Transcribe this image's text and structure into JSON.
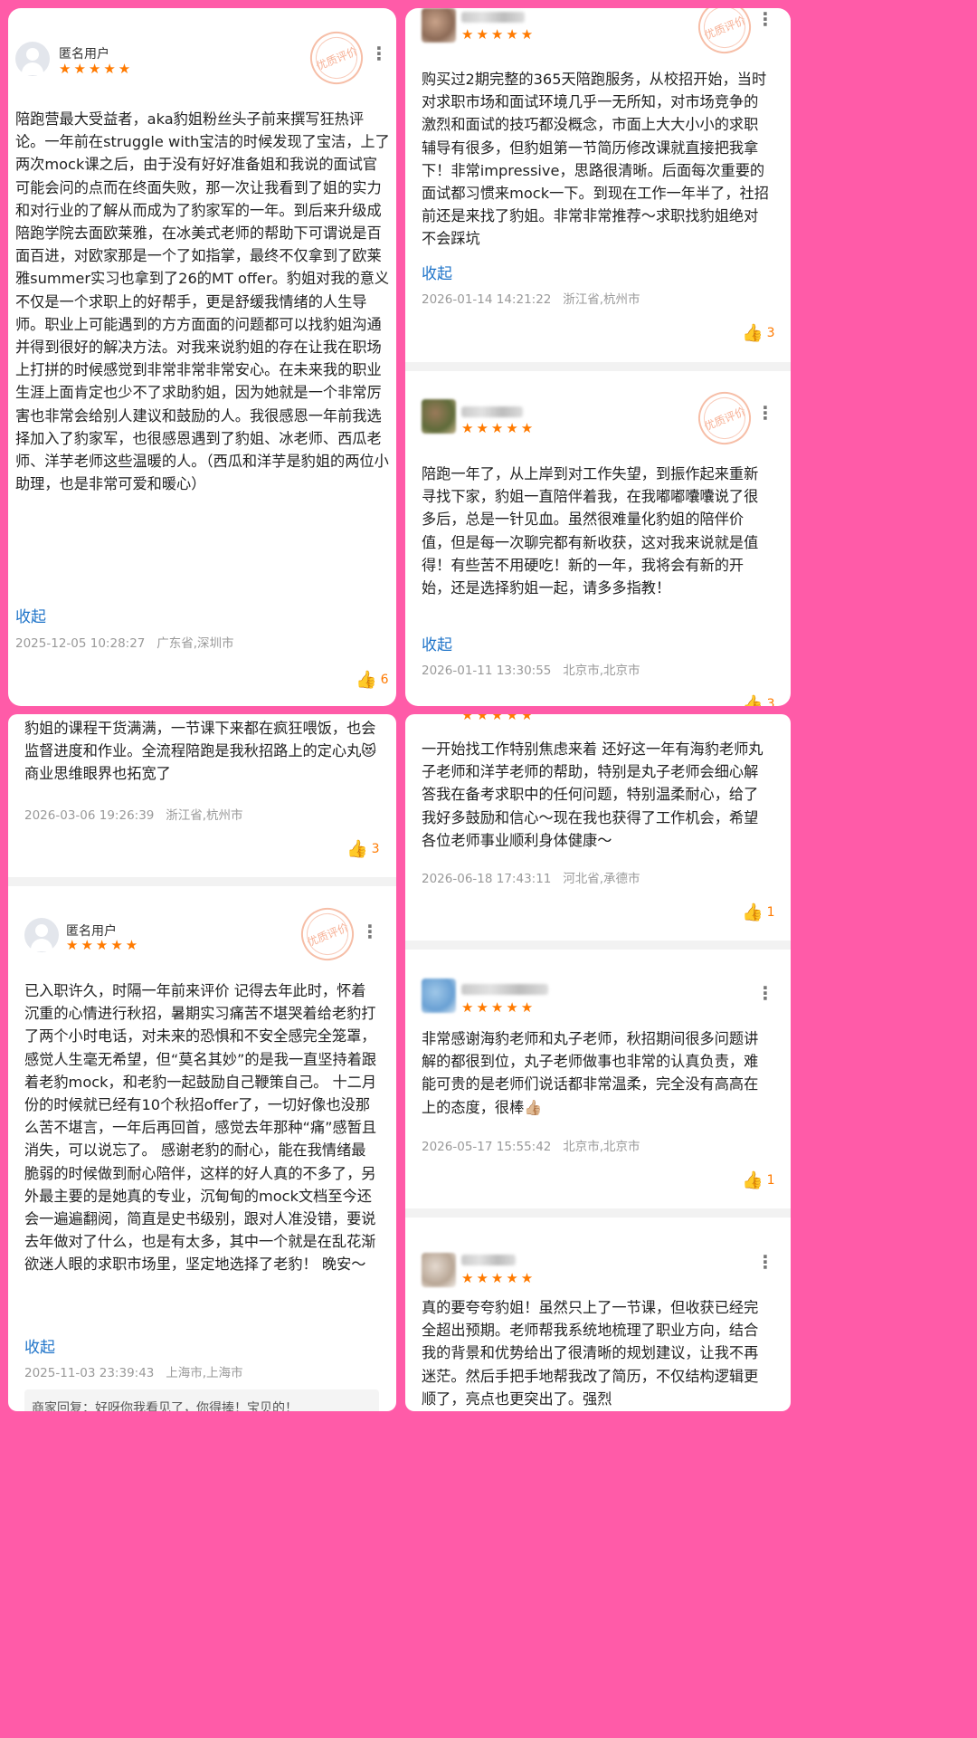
{
  "reviews": [
    {
      "user": "匿名用户",
      "stamp": "优质评价",
      "text": "陪跑营最大受益者，aka豹姐粉丝头子前来撰写狂热评论。一年前在struggle with宝洁的时候发现了宝洁，上了两次mock课之后，由于没有好好准备姐和我说的面试官可能会问的点而在终面失败，那一次让我看到了姐的实力和对行业的了解从而成为了豹家军的一年。到后来升级成陪跑学院去面欧莱雅，在冰美式老师的帮助下可谓说是百面百进，对欧家那是一个了如指掌，最终不仅拿到了欧莱雅summer实习也拿到了26的MT offer。豹姐对我的意义不仅是一个求职上的好帮手，更是舒缓我情绪的人生导师。职业上可能遇到的方方面面的问题都可以找豹姐沟通并得到很好的解决方法。对我来说豹姐的存在让我在职场上打拼的时候感觉到非常非常非常安心。在未来我的职业生涯上面肯定也少不了求助豹姐，因为她就是一个非常厉害也非常会给别人建议和鼓励的人。我很感恩一年前我选择加入了豹家军，也很感恩遇到了豹姐、冰老师、西瓜老师、洋芋老师这些温暖的人。（西瓜和洋芋是豹姐的两位小助理，也是非常可爱和暖心）",
      "collapse": "收起",
      "date": "2025-12-05 10:28:27",
      "location": "广东省,深圳市",
      "likes": "6"
    },
    {
      "stamp": "优质评价",
      "text": "购买过2期完整的365天陪跑服务，从校招开始，当时对求职市场和面试环境几乎一无所知，对市场竞争的激烈和面试的技巧都没概念，市面上大大小小的求职辅导有很多，但豹姐第一节简历修改课就直接把我拿下！非常impressive，思路很清晰。后面每次重要的面试都习惯来mock一下。到现在工作一年半了，社招前还是来找了豹姐。非常非常推荐～求职找豹姐绝对不会踩坑",
      "collapse": "收起",
      "date": "2026-01-14 14:21:22",
      "location": "浙江省,杭州市",
      "likes": "3"
    },
    {
      "stamp": "优质评价",
      "text": "陪跑一年了，从上岸到对工作失望，到振作起来重新寻找下家，豹姐一直陪伴着我，在我嘟嘟囔囔说了很多后，总是一针见血。虽然很难量化豹姐的陪伴价值，但是每一次聊完都有新收获，这对我来说就是值得！有些苦不用硬吃！新的一年，我将会有新的开始，还是选择豹姐一起，请多多指教！",
      "collapse": "收起",
      "date": "2026-01-11 13:30:55",
      "location": "北京市,北京市",
      "likes": "3"
    },
    {
      "text": "豹姐的课程干货满满，一节课下来都在疯狂喂饭，也会监督进度和作业。全流程陪跑是我秋招路上的定心丸😻商业思维眼界也拓宽了",
      "date": "2026-03-06 19:26:39",
      "location": "浙江省,杭州市",
      "likes": "3"
    },
    {
      "text": "一开始找工作特别焦虑来着 还好这一年有海豹老师丸子老师和洋芋老师的帮助，特别是丸子老师会细心解答我在备考求职中的任何问题，特别温柔耐心，给了我好多鼓励和信心～现在我也获得了工作机会，希望各位老师事业顺利身体健康～",
      "date": "2026-06-18 17:43:11",
      "location": "河北省,承德市",
      "likes": "1"
    },
    {
      "user": "匿名用户",
      "stamp": "优质评价",
      "text": "已入职许久，时隔一年前来评价 记得去年此时，怀着沉重的心情进行秋招，暑期实习痛苦不堪哭着给老豹打了两个小时电话，对未来的恐惧和不安全感完全笼罩，感觉人生毫无希望，但“莫名其妙”的是我一直坚持着跟着老豹mock，和老豹一起鼓励自己鞭策自己。 十二月份的时候就已经有10个秋招offer了，一切好像也没那么苦不堪言，一年后再回首，感觉去年那种“痛”感暂且消失，可以说忘了。 感谢老豹的耐心，能在我情绪最脆弱的时候做到耐心陪伴，这样的好人真的不多了，另外最主要的是她真的专业，沉甸甸的mock文档至今还会一遍遍翻阅，简直是史书级别，跟对人准没错，要说去年做对了什么，也是有太多，其中一个就是在乱花渐欲迷人眼的求职市场里，坚定地选择了老豹！ 晚安～",
      "collapse": "收起",
      "date": "2025-11-03 23:39:43",
      "location": "上海市,上海市",
      "reply": "商家回复：好呀你我看见了，你得捧！宝贝的！"
    },
    {
      "text": "非常感谢海豹老师和丸子老师，秋招期间很多问题讲解的都很到位，丸子老师做事也非常的认真负责，难能可贵的是老师们说话都非常温柔，完全没有高高在上的态度，很棒👍🏼",
      "date": "2026-05-17 15:55:42",
      "location": "北京市,北京市",
      "likes": "1"
    },
    {
      "text": "真的要夸夸豹姐！虽然只上了一节课，但收获已经完全超出预期。老师帮我系统地梳理了职业方向，结合我的背景和优势给出了很清晰的规划建议，让我不再迷茫。然后手把手地帮我改了简历，不仅结构逻辑更顺了，亮点也更突出了。强烈"
    }
  ],
  "icons": {
    "star": "★★★★★",
    "more": "more-vertical-icon",
    "thumb": "thumbs-up-icon"
  },
  "colors": {
    "background": "#ff5ba8",
    "star": "#ff7a00",
    "link": "#1f74c9",
    "meta": "#999999"
  }
}
